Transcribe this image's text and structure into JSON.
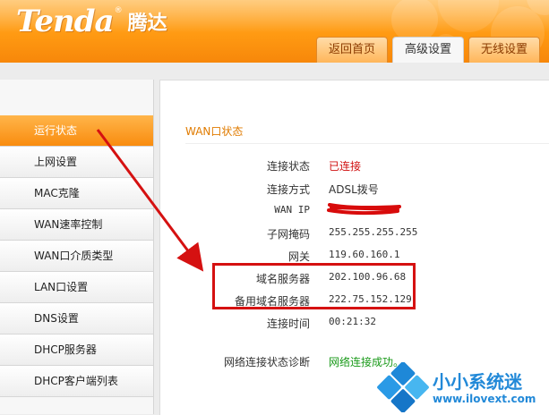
{
  "brand": {
    "logo": "Tenda",
    "reg_mark": "®",
    "name_cn": "腾达"
  },
  "tabs": [
    {
      "label": "返回首页",
      "active": false
    },
    {
      "label": "高级设置",
      "active": true
    },
    {
      "label": "无线设置",
      "active": false
    }
  ],
  "sidebar": {
    "items": [
      {
        "label": "运行状态",
        "active": true
      },
      {
        "label": "上网设置"
      },
      {
        "label": "MAC克隆"
      },
      {
        "label": "WAN速率控制"
      },
      {
        "label": "WAN口介质类型"
      },
      {
        "label": "LAN口设置"
      },
      {
        "label": "DNS设置"
      },
      {
        "label": "DHCP服务器"
      },
      {
        "label": "DHCP客户端列表"
      }
    ]
  },
  "main": {
    "section_title": "WAN口状态",
    "rows": {
      "status": {
        "label": "连接状态",
        "value": "已连接"
      },
      "mode": {
        "label": "连接方式",
        "value": "ADSL拨号"
      },
      "wan_ip": {
        "label": "WAN IP",
        "value": ""
      },
      "subnet": {
        "label": "子网掩码",
        "value": "255.255.255.255"
      },
      "gateway": {
        "label": "网关",
        "value": "119.60.160.1"
      },
      "dns": {
        "label": "域名服务器",
        "value": "202.100.96.68"
      },
      "dns2": {
        "label": "备用域名服务器",
        "value": "222.75.152.129"
      },
      "uptime": {
        "label": "连接时间",
        "value": "00:21:32"
      },
      "diag": {
        "label": "网络连接状态诊断",
        "value": "网络连接成功。"
      }
    }
  },
  "watermark": {
    "name_cn": "小小系统迷",
    "url": "www.ilovext.com"
  },
  "colors": {
    "brand_orange": "#ff9a12",
    "active_nav": "#f98c0f",
    "status_red": "#d01010",
    "diag_green": "#1a9a1a",
    "annotation_red": "#d51111",
    "watermark_blue": "#2289d8"
  }
}
